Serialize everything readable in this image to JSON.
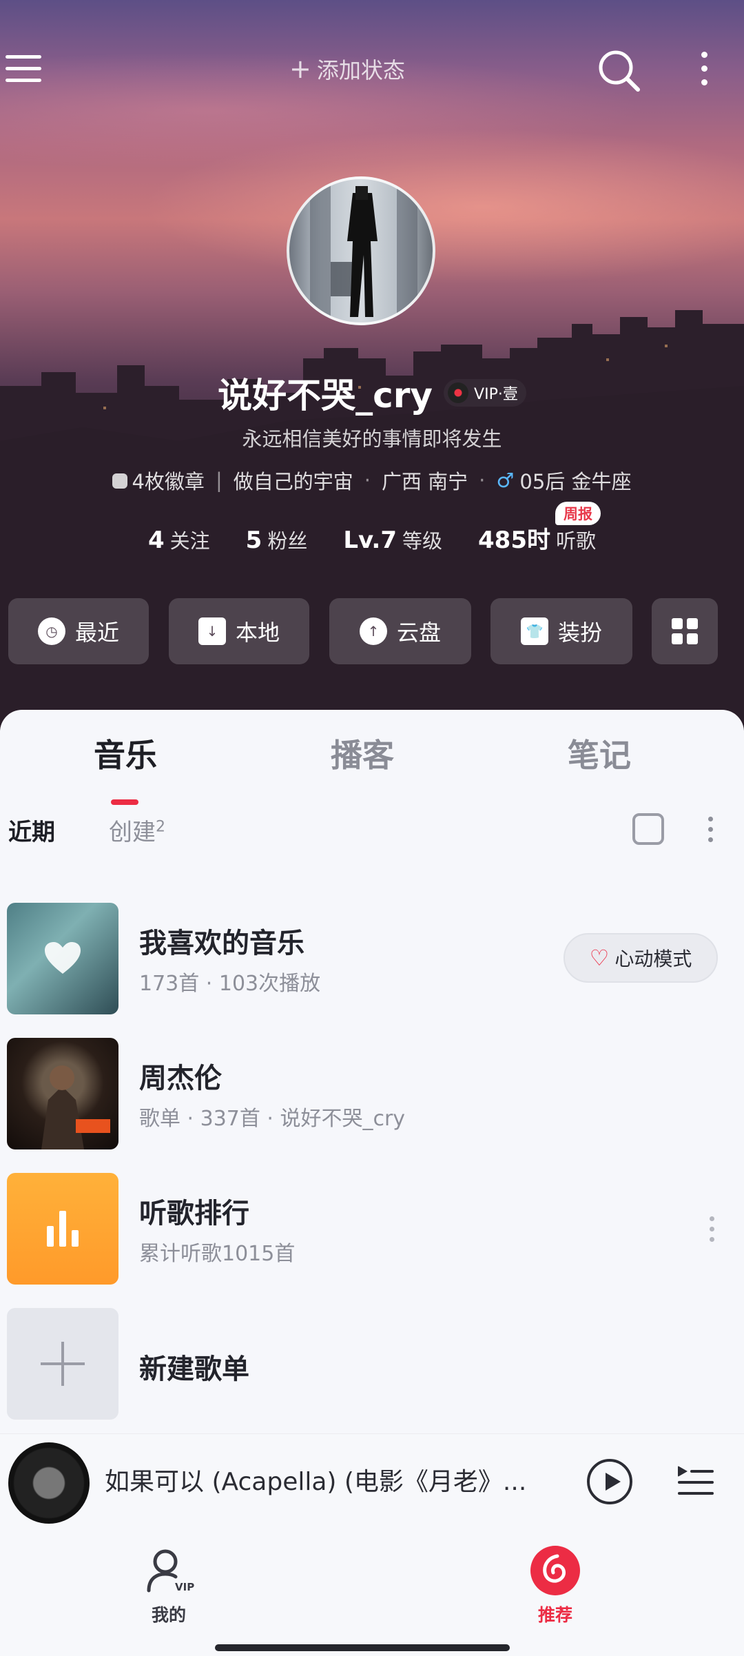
{
  "header": {
    "add_status_label": "添加状态"
  },
  "profile": {
    "username": "说好不哭_cry",
    "vip_label": "VIP·壹",
    "signature": "永远相信美好的事情即将发生",
    "badges": "4枚徽章",
    "tagline": "做自己的宇宙",
    "location": "广西 南宁",
    "gender_symbol": "♂",
    "age_sign": "05后 金牛座",
    "stats": {
      "following_count": "4",
      "following_label": "关注",
      "fans_count": "5",
      "fans_label": "粉丝",
      "level_value": "Lv.7",
      "level_label": "等级",
      "hours_value": "485时",
      "hours_label": "听歌",
      "weekly_badge": "周报"
    }
  },
  "quick_actions": [
    {
      "label": "最近",
      "icon": "clock-icon"
    },
    {
      "label": "本地",
      "icon": "download-icon"
    },
    {
      "label": "云盘",
      "icon": "cloud-upload-icon"
    },
    {
      "label": "装扮",
      "icon": "shirt-icon"
    },
    {
      "label": "",
      "icon": "apps-grid-icon"
    }
  ],
  "tabs": [
    {
      "label": "音乐",
      "active": true
    },
    {
      "label": "播客",
      "active": false
    },
    {
      "label": "笔记",
      "active": false
    }
  ],
  "subtabs": {
    "recent": "近期",
    "created": "创建",
    "created_count": "2"
  },
  "playlists": [
    {
      "title": "我喜欢的音乐",
      "subtitle": "173首 · 103次播放",
      "action": "心动模式"
    },
    {
      "title": "周杰伦",
      "subtitle": "歌单 · 337首 · 说好不哭_cry"
    },
    {
      "title": "听歌排行",
      "subtitle": "累计听歌1015首"
    },
    {
      "title": "新建歌单"
    }
  ],
  "player": {
    "song_title": "如果可以 (Acapella) (电影《月老》..."
  },
  "bottom_nav": [
    {
      "label": "我的"
    },
    {
      "label": "推荐"
    }
  ],
  "colors": {
    "accent": "#ec2c44",
    "rank_cover": "#ff9f2e"
  }
}
